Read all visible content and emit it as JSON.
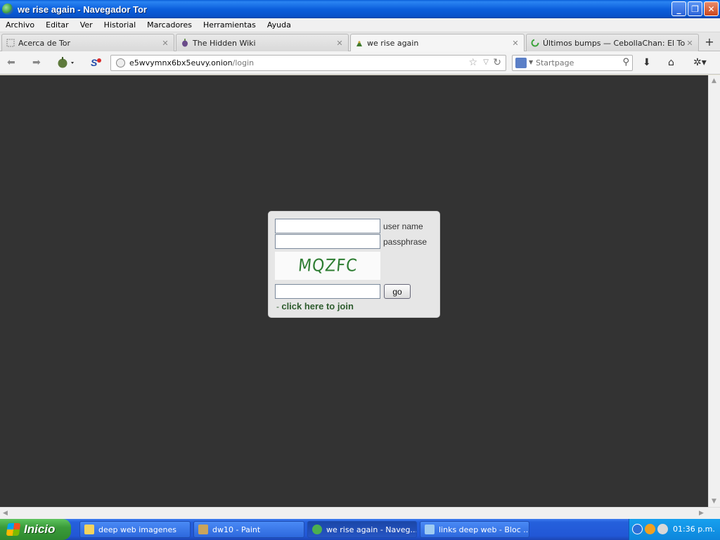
{
  "window": {
    "title": "we rise again - Navegador Tor",
    "buttons": [
      "_",
      "❐",
      "✕"
    ]
  },
  "menu": [
    {
      "label": "Archivo"
    },
    {
      "label": "Editar"
    },
    {
      "label": "Ver"
    },
    {
      "label": "Historial"
    },
    {
      "label": "Marcadores"
    },
    {
      "label": "Herramientas"
    },
    {
      "label": "Ayuda"
    }
  ],
  "tabs": [
    {
      "label": "Acerca de Tor",
      "active": false
    },
    {
      "label": "The Hidden Wiki",
      "active": false
    },
    {
      "label": "we rise again",
      "active": true
    },
    {
      "label": "Últimos bumps — CebollaChan: El Tor-ch...",
      "active": false
    }
  ],
  "new_tab_label": "+",
  "nav": {
    "url_host": "e5wvymnx6bx5euvy.onion",
    "url_path": "/login",
    "search_placeholder": "Startpage"
  },
  "login": {
    "username_label": "user name",
    "passphrase_label": "passphrase",
    "captcha_text": "MQZFC",
    "go_label": "go",
    "join_prefix": "- ",
    "join_link": "click here to join",
    "captcha_color": "#2e7d32"
  },
  "taskbar": {
    "start_label": "Inicio",
    "items": [
      {
        "label": "deep web imagenes",
        "active": false
      },
      {
        "label": "dw10 - Paint",
        "active": false
      },
      {
        "label": "we rise again - Naveg...",
        "active": true
      },
      {
        "label": "links deep web - Bloc ...",
        "active": false
      }
    ],
    "clock": "01:36 p.m."
  },
  "colors": {
    "page_background": "#333333",
    "titlebar": "#0b5fdc",
    "taskbar": "#2257d6"
  }
}
